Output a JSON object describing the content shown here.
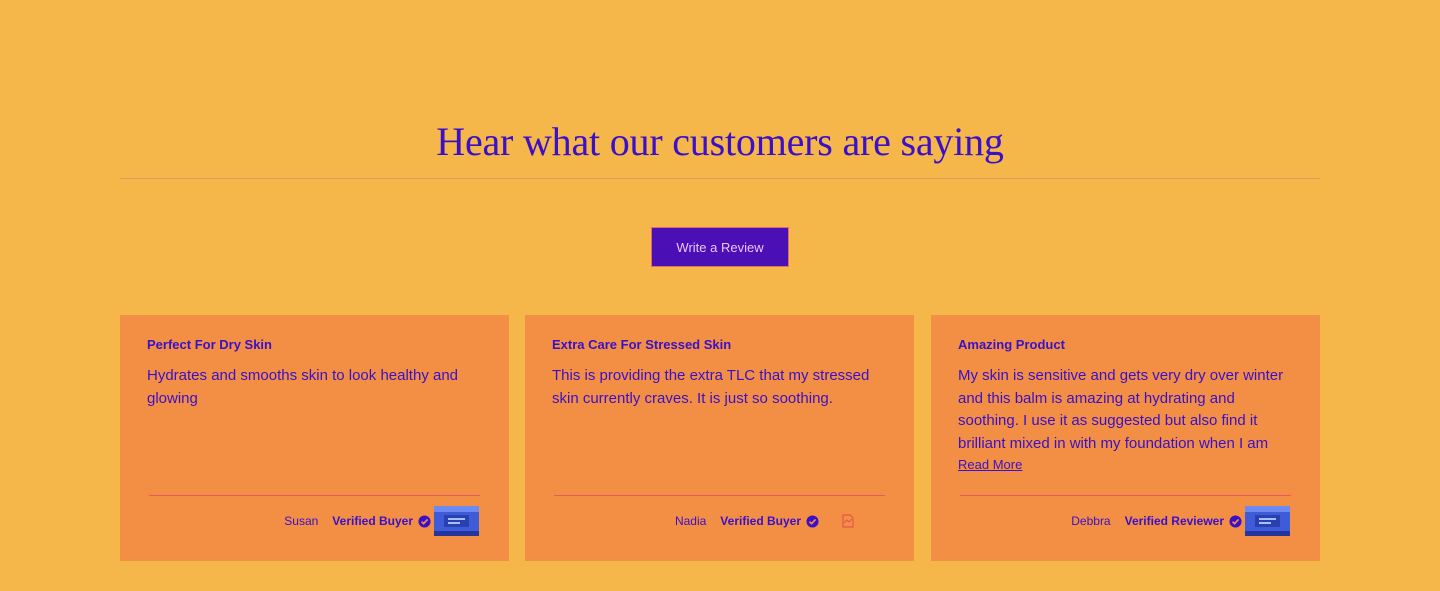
{
  "section": {
    "heading": "Hear what our customers are saying",
    "write_review_label": "Write a Review"
  },
  "reviews": [
    {
      "title": "Perfect For Dry Skin",
      "body": "Hydrates and smooths skin to look healthy and glowing",
      "author": "Susan",
      "badge": "Verified Buyer",
      "has_product_image": true
    },
    {
      "title": "Extra Care For Stressed Skin",
      "body": "This is providing the extra TLC that my stressed skin currently craves. It is just so soothing.",
      "author": "Nadia",
      "badge": "Verified Buyer",
      "has_product_image": false
    },
    {
      "title": "Amazing Product",
      "body": "My skin is sensitive and gets very dry over winter and this balm is amazing at hydrating and soothing. I use it as suggested but also find it brilliant mixed in with my foundation when I am",
      "read_more": "Read More",
      "author": "Debbra",
      "badge": "Verified Reviewer",
      "has_product_image": true
    }
  ],
  "colors": {
    "background": "#F6B74A",
    "card": "#F28F45",
    "text": "#3A10C8",
    "button": "#4A0FB5",
    "accent_line": "#E65C5C"
  },
  "icons": {
    "verified": "check-circle-icon",
    "product": "product-jar-thumbnail",
    "missing_image": "broken-image-icon"
  }
}
